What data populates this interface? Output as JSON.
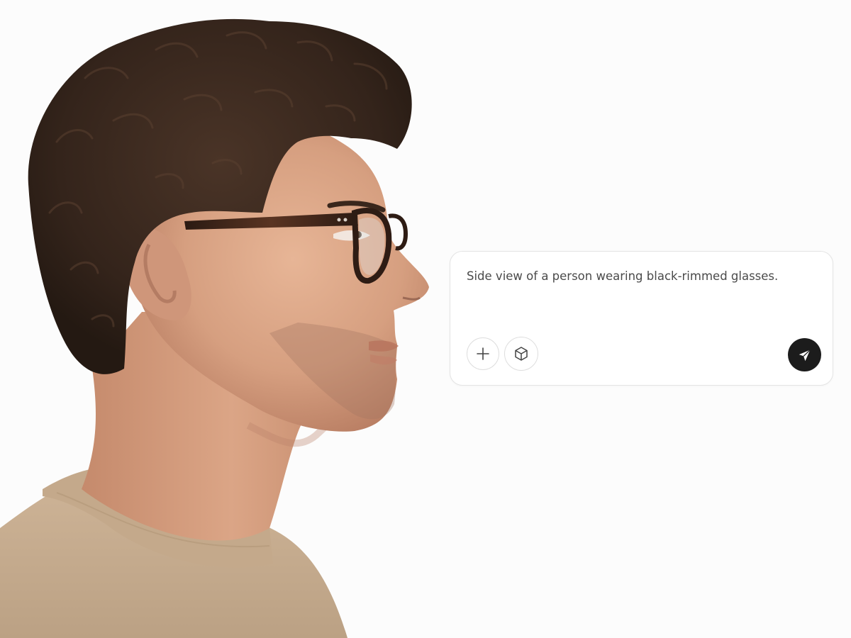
{
  "prompt": {
    "text": "Side view of a person wearing black-rimmed glasses."
  },
  "toolbar": {
    "add_icon": "plus-icon",
    "model_icon": "cube-icon",
    "send_icon": "send-icon"
  },
  "photo": {
    "subject": "photo"
  },
  "colors": {
    "background": "#fcfcfc",
    "card_border": "#e4e4e4",
    "send_button": "#1c1c1c",
    "prompt_text": "#4a4a4a"
  }
}
